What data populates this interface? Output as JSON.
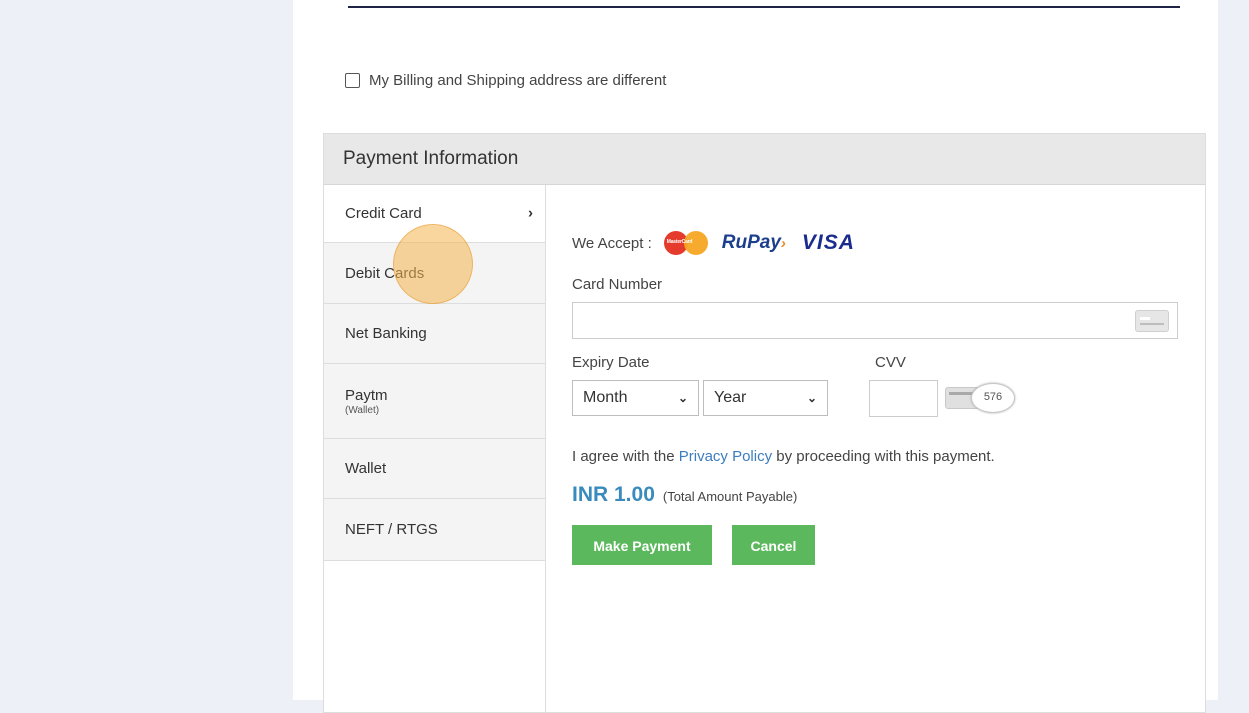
{
  "billing": {
    "label": "My Billing and Shipping address are different",
    "checked": false
  },
  "payment": {
    "header": "Payment Information",
    "tabs": [
      {
        "label": "Credit Card",
        "sub": "",
        "active": true
      },
      {
        "label": "Debit Cards",
        "sub": ""
      },
      {
        "label": "Net Banking",
        "sub": ""
      },
      {
        "label": "Paytm",
        "sub": "(Wallet)"
      },
      {
        "label": "Wallet",
        "sub": ""
      },
      {
        "label": "NEFT / RTGS",
        "sub": ""
      }
    ],
    "chevron": "›",
    "we_accept": "We Accept :",
    "logos": {
      "mastercard_text": "MasterCard",
      "rupay": "RuPay",
      "visa": "VISA"
    },
    "card_number_label": "Card Number",
    "card_number_value": "",
    "expiry_label": "Expiry Date",
    "month": {
      "selected": "Month"
    },
    "year": {
      "selected": "Year"
    },
    "cvv_label": "CVV",
    "cvv_value": "",
    "cvv_hint": "576",
    "agree_prefix": "I agree with the ",
    "privacy_link": "Privacy Policy",
    "agree_suffix": " by proceeding with this payment.",
    "amount": "INR 1.00",
    "amount_note": "(Total Amount Payable)",
    "make_payment": "Make Payment",
    "cancel": "Cancel",
    "colors": {
      "button": "#5cb85c",
      "amount": "#3a8bbd",
      "link": "#3b7dbf"
    }
  }
}
